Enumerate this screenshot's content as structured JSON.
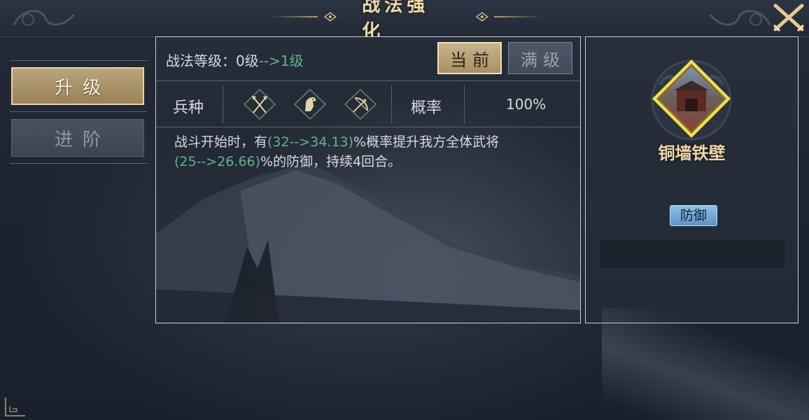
{
  "header": {
    "title": "战法强化",
    "close_icon": "crossed-swords-close-icon"
  },
  "sidebar": {
    "items": [
      {
        "label": "升级",
        "active": true
      },
      {
        "label": "进阶",
        "active": false
      }
    ]
  },
  "main": {
    "level_label": "战法等级：0级",
    "level_to": "-->1级",
    "tabs": [
      {
        "label": "当前",
        "active": true
      },
      {
        "label": "满级",
        "active": false
      }
    ],
    "troop_label": "兵种",
    "troop_icons": [
      "halberd-icon",
      "horse-icon",
      "bow-icon"
    ],
    "prob_label": "概率",
    "prob_value": "100%",
    "desc": {
      "p1": "战斗开始时，有",
      "g1": "(32-->34.13)",
      "p2": "%概率提升我方全体武将",
      "g2": "(25-->26.66)",
      "p3": "%的防御，持续4回合。"
    }
  },
  "skill": {
    "name": "铜墙铁壁",
    "type": "防御",
    "emblem_icon": "fortress-emblem-icon"
  },
  "colors": {
    "accent_gold": "#e8d3a0",
    "green": "#5fb58b",
    "badge_blue": "#6ea3d1"
  }
}
